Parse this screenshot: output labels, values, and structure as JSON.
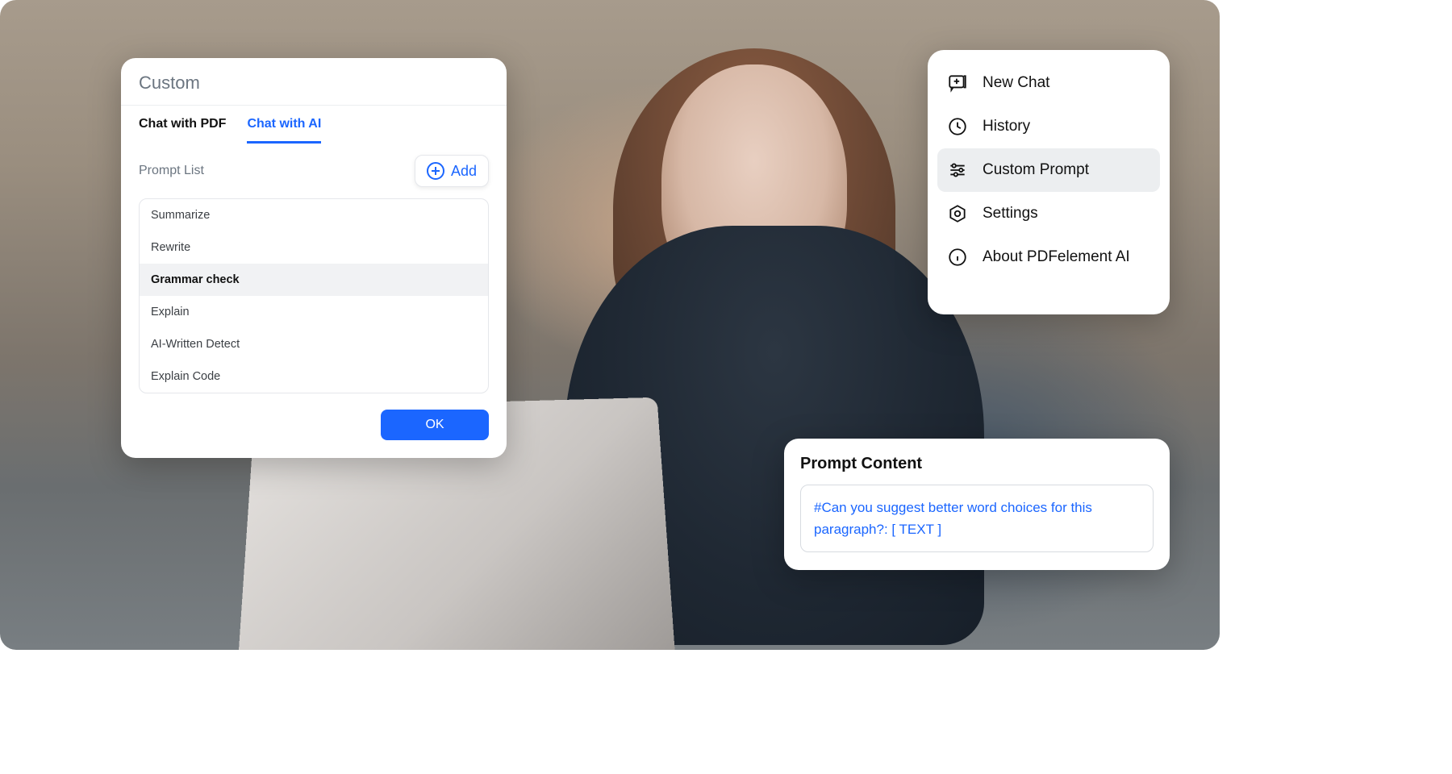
{
  "colors": {
    "accent": "#1b66ff"
  },
  "custom_panel": {
    "title": "Custom",
    "tabs": [
      {
        "label": "Chat with PDF",
        "active": false
      },
      {
        "label": "Chat with AI",
        "active": true
      }
    ],
    "prompt_list_label": "Prompt List",
    "add_label": "Add",
    "items": [
      {
        "label": "Summarize",
        "selected": false
      },
      {
        "label": "Rewrite",
        "selected": false
      },
      {
        "label": "Grammar check",
        "selected": true
      },
      {
        "label": "Explain",
        "selected": false
      },
      {
        "label": "AI-Written Detect",
        "selected": false
      },
      {
        "label": "Explain Code",
        "selected": false
      }
    ],
    "ok_label": "OK"
  },
  "menu_panel": {
    "items": [
      {
        "icon": "new-chat-icon",
        "label": "New Chat",
        "selected": false
      },
      {
        "icon": "history-icon",
        "label": "History",
        "selected": false
      },
      {
        "icon": "sliders-icon",
        "label": "Custom Prompt",
        "selected": true
      },
      {
        "icon": "settings-icon",
        "label": "Settings",
        "selected": false
      },
      {
        "icon": "info-icon",
        "label": "About PDFelement AI",
        "selected": false
      }
    ]
  },
  "prompt_content": {
    "title": "Prompt Content",
    "text": "#Can you suggest better word choices for this paragraph?: [ TEXT ]"
  }
}
